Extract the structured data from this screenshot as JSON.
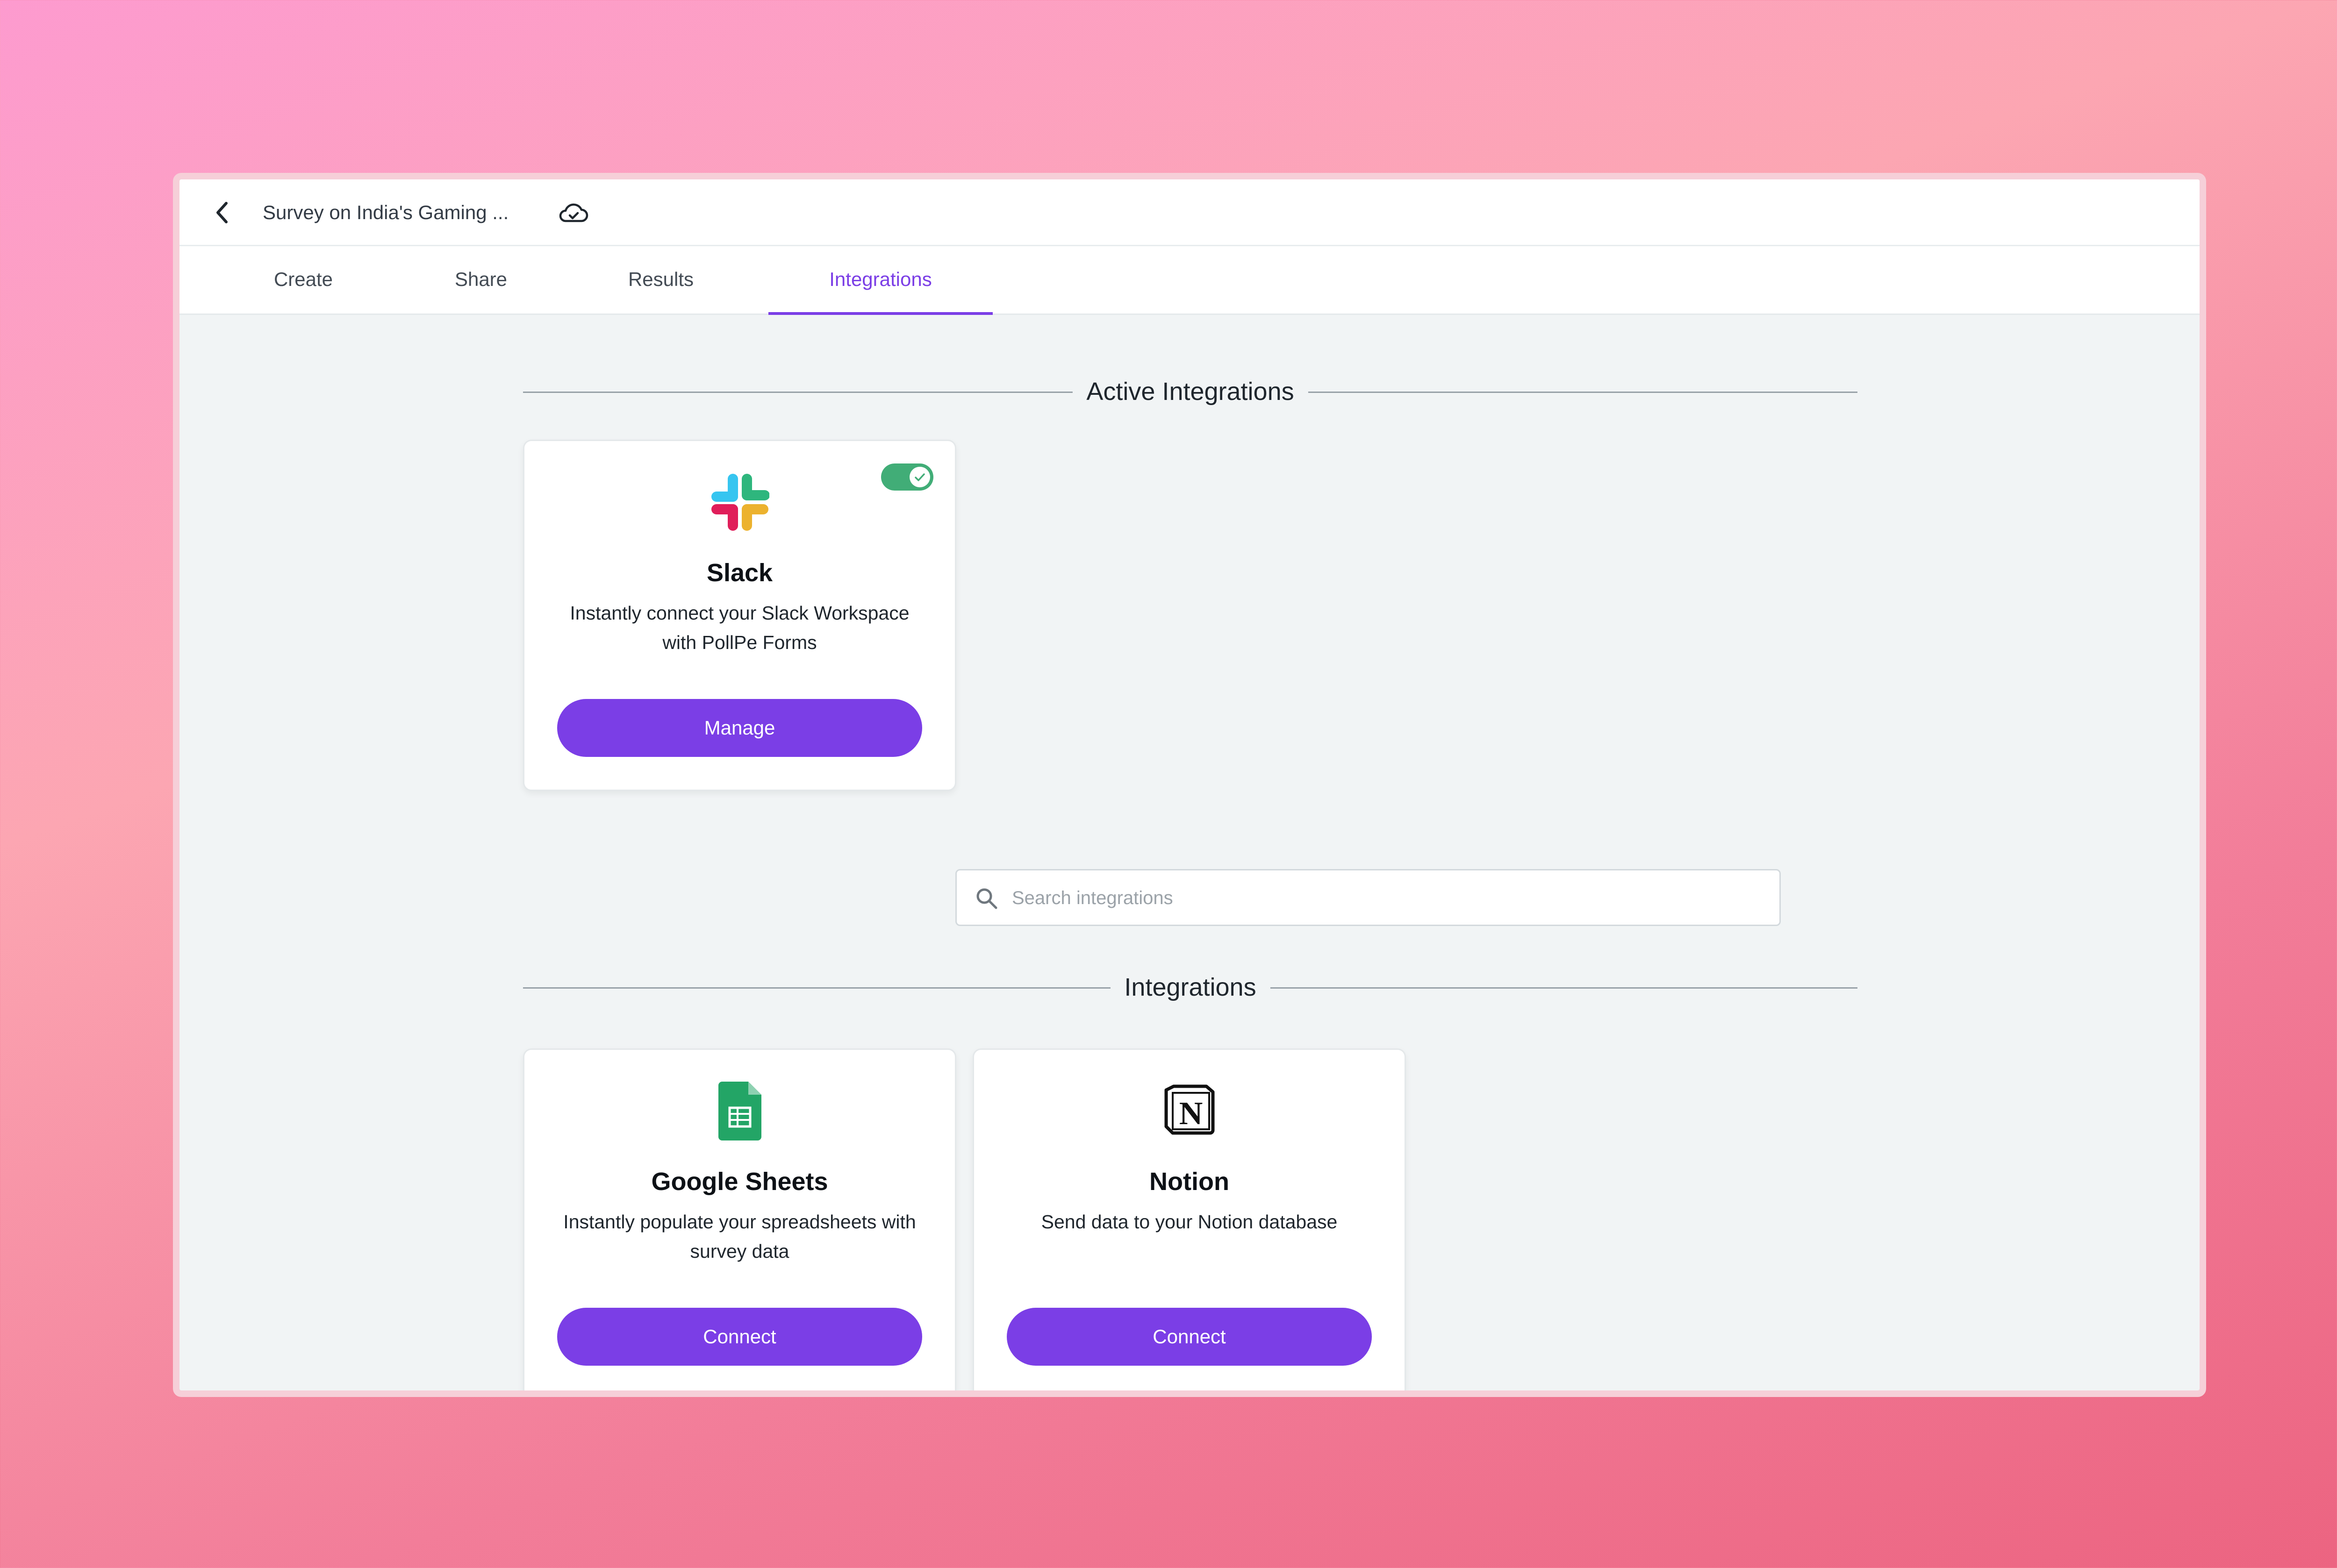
{
  "window": {
    "title": "Survey on India's Gaming ..."
  },
  "tabs": [
    {
      "label": "Create",
      "active": false
    },
    {
      "label": "Share",
      "active": false
    },
    {
      "label": "Results",
      "active": false
    },
    {
      "label": "Integrations",
      "active": true
    }
  ],
  "active_section": {
    "heading": "Active Integrations",
    "cards": [
      {
        "icon": "slack-logo-icon",
        "title": "Slack",
        "description": "Instantly connect your Slack Workspace with PollPe Forms",
        "button_label": "Manage",
        "enabled": true
      }
    ]
  },
  "search": {
    "placeholder": "Search integrations",
    "value": ""
  },
  "integrations_section": {
    "heading": "Integrations",
    "cards": [
      {
        "icon": "google-sheets-icon",
        "title": "Google Sheets",
        "description": "Instantly populate your spreadsheets with survey data",
        "button_label": "Connect"
      },
      {
        "icon": "notion-icon",
        "title": "Notion",
        "description": "Send data to your Notion database",
        "button_label": "Connect"
      }
    ]
  },
  "colors": {
    "accent": "#7b3ee6",
    "toggle_on": "#41ad77",
    "page_background": "#f1f4f5"
  }
}
